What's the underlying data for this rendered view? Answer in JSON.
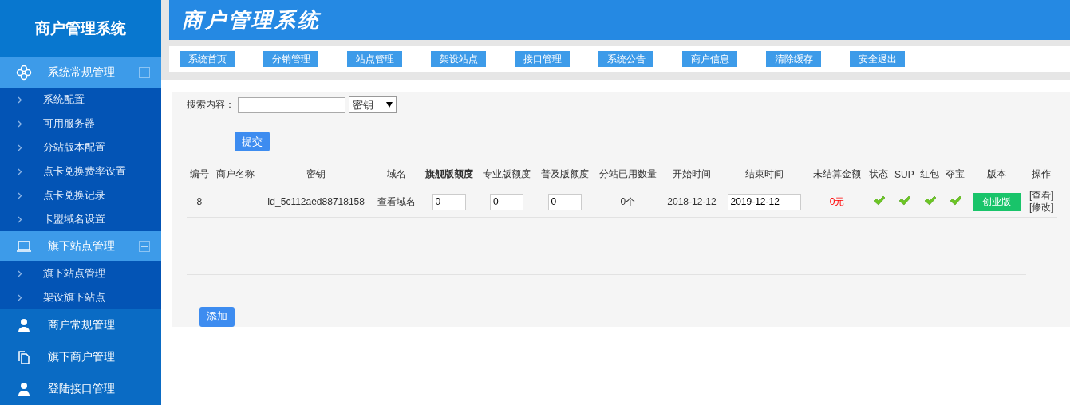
{
  "sidebar": {
    "logo": "商户管理系统",
    "groups": [
      {
        "title": "系统常规管理",
        "expanded": true,
        "items": [
          "系统配置",
          "可用服务器",
          "分站版本配置",
          "点卡兑换费率设置",
          "点卡兑换记录",
          "卡盟域名设置"
        ]
      },
      {
        "title": "旗下站点管理",
        "expanded": true,
        "items": [
          "旗下站点管理",
          "架设旗下站点"
        ]
      },
      {
        "title": "商户常规管理",
        "expanded": false
      },
      {
        "title": "旗下商户管理",
        "expanded": false
      },
      {
        "title": "登陆接口管理",
        "expanded": false
      }
    ]
  },
  "header": {
    "title": "商户管理系统"
  },
  "nav": [
    "系统首页",
    "分销管理",
    "站点管理",
    "架设站点",
    "接口管理",
    "系统公告",
    "商户信息",
    "清除缓存",
    "安全退出"
  ],
  "search": {
    "label": "搜索内容：",
    "select": "密钥",
    "submit": "提交"
  },
  "table": {
    "columns": [
      "编号",
      "商户名称",
      "密钥",
      "域名",
      "旗舰版额度",
      "专业版额度",
      "普及版额度",
      "分站已用数量",
      "开始时间",
      "结束时间",
      "未结算金额",
      "状态",
      "SUP",
      "红包",
      "夺宝",
      "版本",
      "操作"
    ],
    "rows": [
      {
        "id": "8",
        "key": "Id_5c112aed88718158",
        "domain": "查看域名",
        "flagship": "0",
        "pro": "0",
        "basic": "0",
        "used": "0个",
        "start": "2018-12-12",
        "end": "2019-12-12",
        "unsettled": "0元",
        "status": true,
        "sup": true,
        "hongbao": true,
        "duobao": true,
        "version": "创业版",
        "actions": [
          "[查看]",
          "[修改]"
        ]
      }
    ]
  },
  "add_button": "添加"
}
